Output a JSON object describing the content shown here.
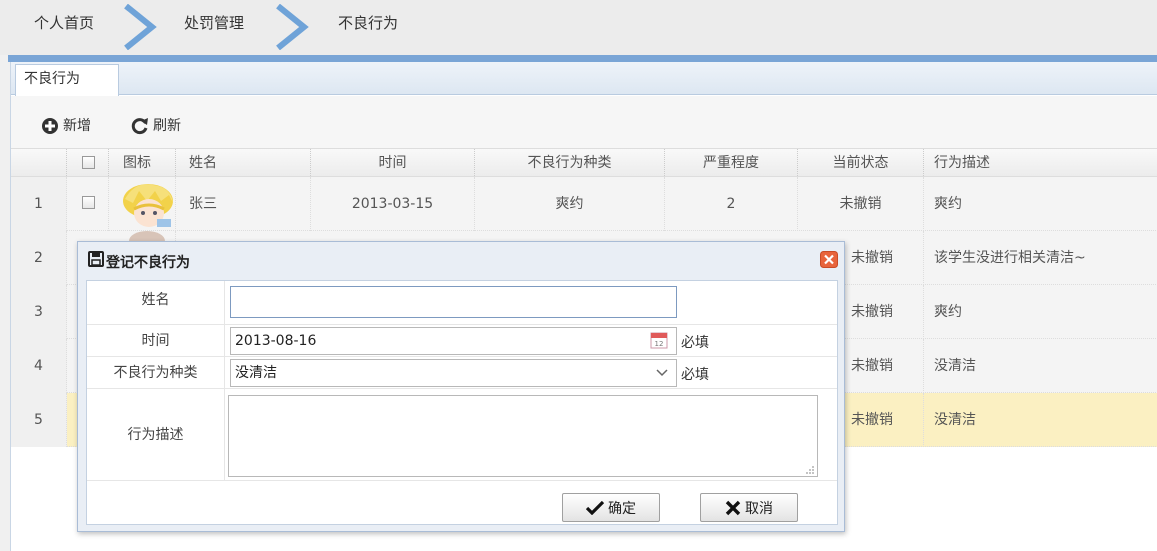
{
  "breadcrumb": {
    "items": [
      "个人首页",
      "处罚管理",
      "不良行为"
    ]
  },
  "tabs": [
    {
      "label": "不良行为"
    }
  ],
  "toolbar": {
    "add_label": "新增",
    "refresh_label": "刷新"
  },
  "grid": {
    "headers": {
      "icon": "图标",
      "name": "姓名",
      "time": "时间",
      "type": "不良行为种类",
      "severity": "严重程度",
      "status": "当前状态",
      "desc": "行为描述"
    },
    "rows": [
      {
        "num": "1",
        "name": "张三",
        "time": "2013-03-15",
        "type": "爽约",
        "severity": "2",
        "status": "未撤销",
        "desc": "爽约"
      },
      {
        "num": "2",
        "name": "",
        "time": "",
        "type": "",
        "severity": "",
        "status": "未撤销",
        "desc": "该学生没进行相关清洁~"
      },
      {
        "num": "3",
        "name": "",
        "time": "",
        "type": "",
        "severity": "",
        "status": "未撤销",
        "desc": "爽约"
      },
      {
        "num": "4",
        "name": "",
        "time": "",
        "type": "",
        "severity": "",
        "status": "未撤销",
        "desc": "没清洁"
      },
      {
        "num": "5",
        "name": "",
        "time": "",
        "type": "",
        "severity": "",
        "status": "未撤销",
        "desc": "没清洁"
      }
    ]
  },
  "dialog": {
    "title": "登记不良行为",
    "fields": {
      "name_label": "姓名",
      "name_value": "",
      "time_label": "时间",
      "time_value": "2013-08-16",
      "time_required": "必填",
      "type_label": "不良行为种类",
      "type_value": "没清洁",
      "type_required": "必填",
      "desc_label": "行为描述",
      "desc_value": ""
    },
    "confirm_label": "确定",
    "cancel_label": "取消"
  },
  "colors": {
    "accent": "#7aa5d6",
    "close_button": "#e8643c",
    "selected_row": "#fbf0c2"
  }
}
